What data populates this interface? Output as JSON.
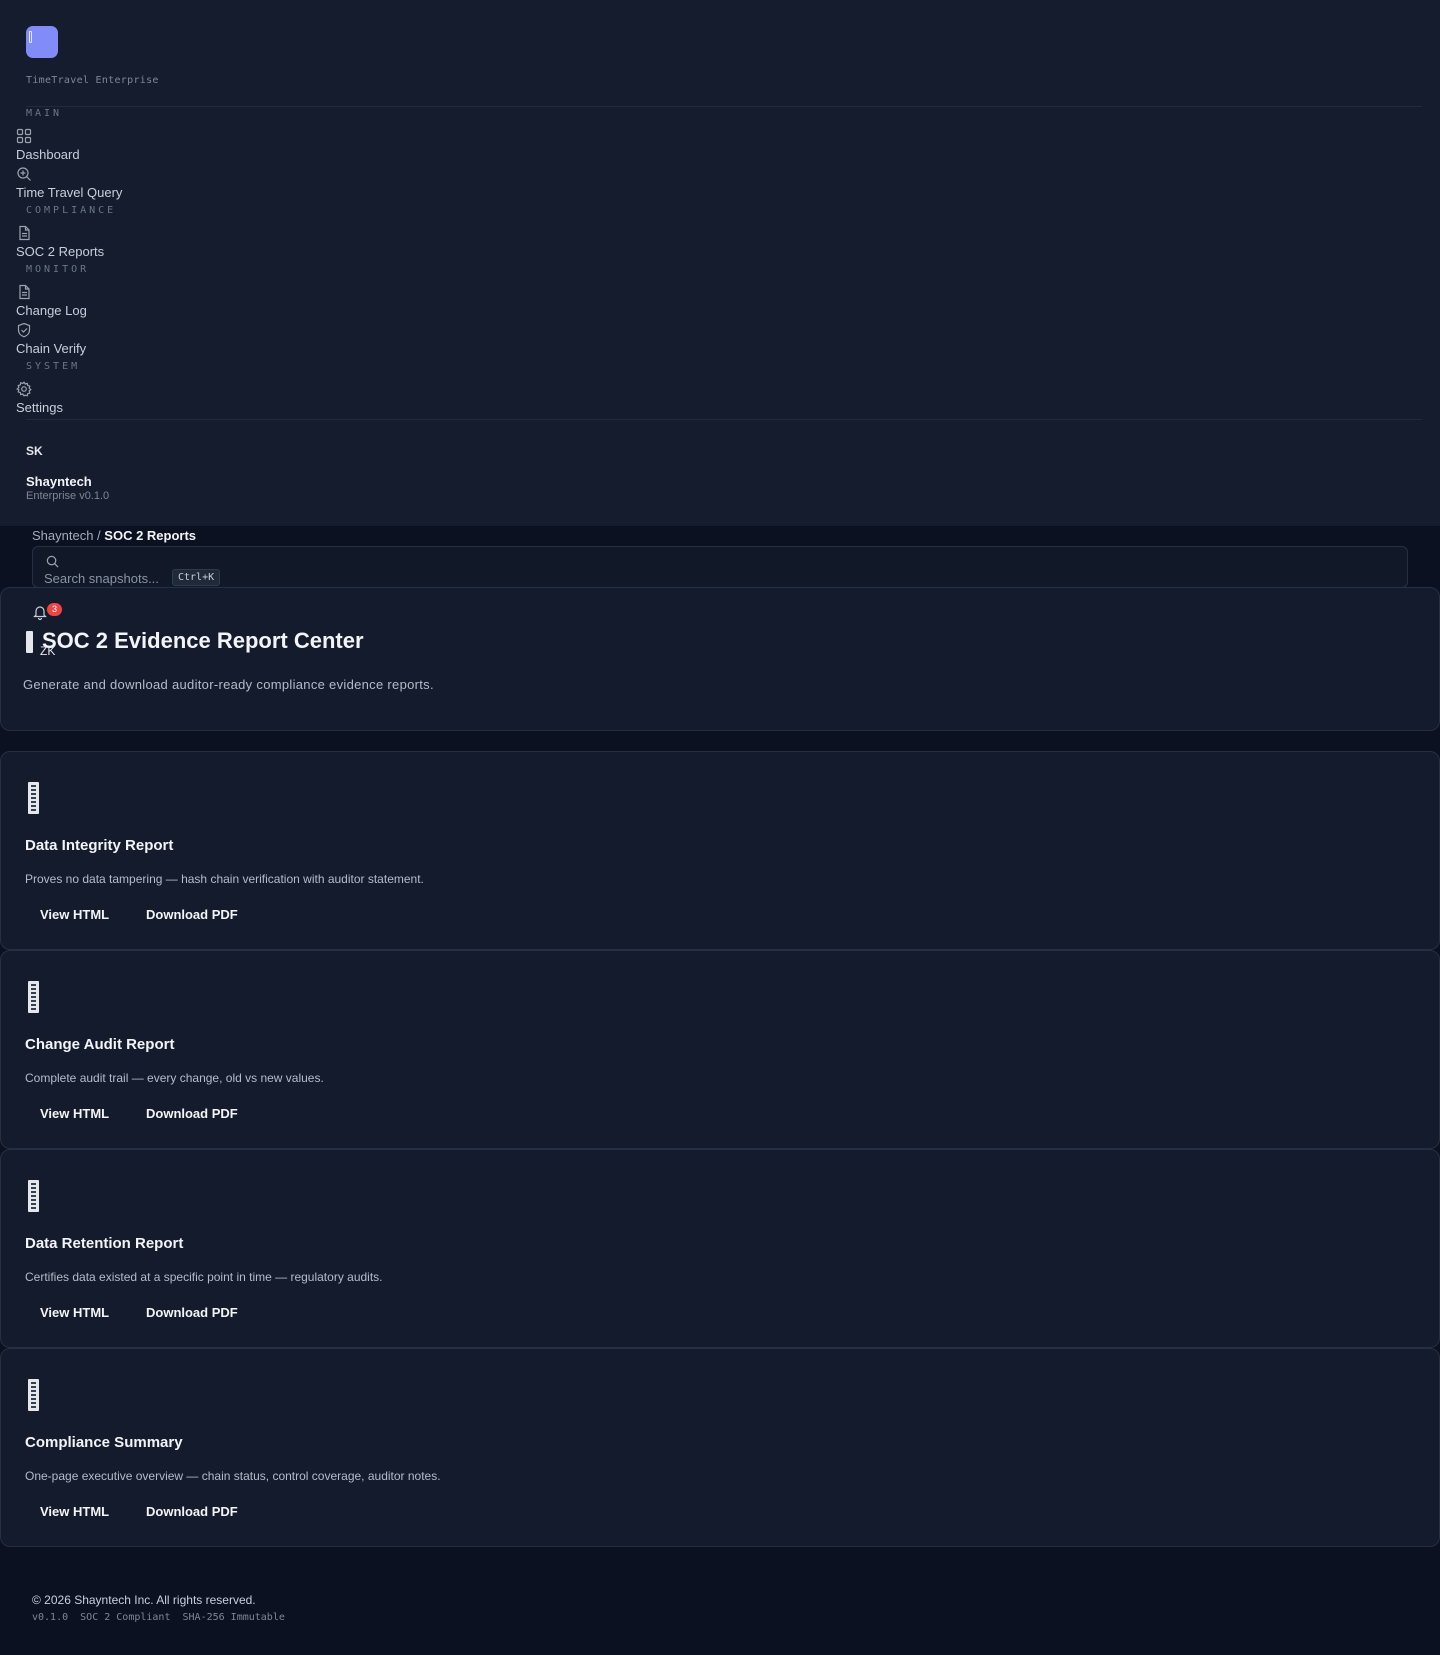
{
  "app": {
    "brand_subtitle": "TimeTravel Enterprise"
  },
  "sidebar": {
    "sections": {
      "main": "MAIN",
      "compliance": "COMPLIANCE",
      "monitor": "MONITOR",
      "system": "SYSTEM"
    },
    "items": {
      "dashboard": "Dashboard",
      "time_travel_query": "Time Travel Query",
      "soc2_reports": "SOC 2 Reports",
      "change_log": "Change Log",
      "chain_verify": "Chain Verify",
      "settings": "Settings"
    },
    "user": {
      "initials": "SK",
      "name": "Shayntech",
      "subtitle": "Enterprise v0.1.0"
    }
  },
  "topbar": {
    "breadcrumb_root": "Shayntech",
    "breadcrumb_separator": " / ",
    "breadcrumb_current": "SOC 2 Reports",
    "search_placeholder": "Search snapshots...",
    "search_shortcut": "Ctrl+K",
    "notification_count": "3",
    "user_initials": "ZK"
  },
  "header": {
    "title": "SOC 2 Evidence Report Center",
    "subtitle": "Generate and download auditor-ready compliance evidence reports."
  },
  "reports": [
    {
      "title": "Data Integrity Report",
      "description": "Proves no data tampering — hash chain verification with auditor statement.",
      "view_label": "View HTML",
      "download_label": "Download PDF"
    },
    {
      "title": "Change Audit Report",
      "description": "Complete audit trail — every change, old vs new values.",
      "view_label": "View HTML",
      "download_label": "Download PDF"
    },
    {
      "title": "Data Retention Report",
      "description": "Certifies data existed at a specific point in time — regulatory audits.",
      "view_label": "View HTML",
      "download_label": "Download PDF"
    },
    {
      "title": "Compliance Summary",
      "description": "One-page executive overview — chain status, control coverage, auditor notes.",
      "view_label": "View HTML",
      "download_label": "Download PDF"
    }
  ],
  "footer": {
    "copyright": "© 2026 Shayntech Inc. All rights reserved.",
    "meta": "v0.1.0  SOC 2 Compliant  SHA-256 Immutable"
  },
  "colors": {
    "background": "#0b1120",
    "sidebar": "#151c2e",
    "card": "#141b2d",
    "accent": "#818cf8",
    "badge": "#ef4444"
  }
}
